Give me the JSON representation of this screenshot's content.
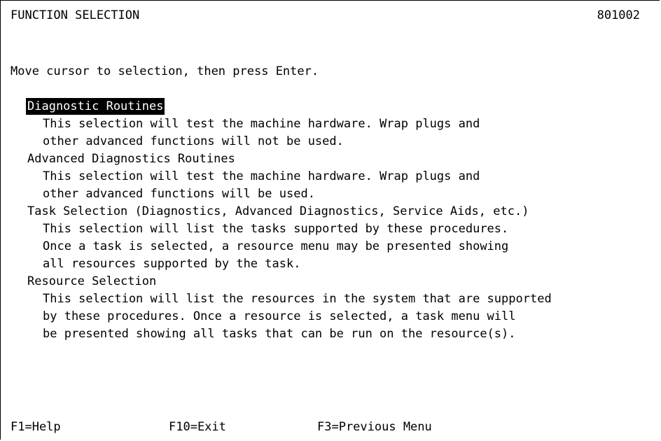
{
  "header": {
    "title": "FUNCTION SELECTION",
    "screen_id": "801002"
  },
  "instruction": "Move cursor to selection, then press Enter.",
  "menu": [
    {
      "label": "Diagnostic Routines",
      "selected": true,
      "description": [
        "This selection will test the machine hardware. Wrap plugs and",
        "other advanced functions will not be used."
      ]
    },
    {
      "label": "Advanced Diagnostics Routines",
      "selected": false,
      "description": [
        "This selection will test the machine hardware. Wrap plugs and",
        "other advanced functions will be used."
      ]
    },
    {
      "label": "Task Selection (Diagnostics, Advanced Diagnostics, Service Aids, etc.)",
      "selected": false,
      "description": [
        "This selection will list the tasks supported by these procedures.",
        "Once a task is selected, a resource menu may be presented showing",
        "all resources supported by the task."
      ]
    },
    {
      "label": "Resource Selection",
      "selected": false,
      "description": [
        "This selection will list the resources in the system that are supported",
        "by these procedures. Once a resource is selected, a task menu will",
        "be presented showing all tasks that can be run on the resource(s)."
      ]
    }
  ],
  "function_keys": [
    {
      "label": "F1=Help"
    },
    {
      "label": "F10=Exit"
    },
    {
      "label": "F3=Previous Menu"
    }
  ],
  "colors": {
    "background": "#ffffff",
    "foreground": "#000000",
    "highlight_background": "#000000",
    "highlight_foreground": "#ffffff"
  }
}
